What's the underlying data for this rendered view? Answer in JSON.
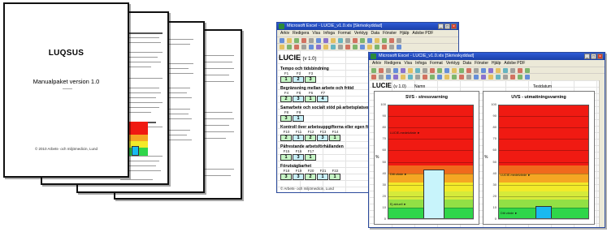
{
  "manual": {
    "title": "LUQSUS",
    "subtitle": "Manualpaket version 1.0",
    "copyright": "© 2010 Arbets- och miljömedicin, Lund"
  },
  "back_window": {
    "title_bar": "Microsoft Excel - LUCIE_v1.0.xls [Skrivskyddad]",
    "menu": [
      "Arkiv",
      "Redigera",
      "Visa",
      "Infoga",
      "Format",
      "Verktyg",
      "Data",
      "Fönster",
      "Hjälp",
      "Adobe PDF"
    ],
    "sheet_title": "LUCIE",
    "sheet_version": "(v 1.0)",
    "sections": [
      {
        "heading": "Tempo och tidsbindning",
        "labels": [
          "F1",
          "F2",
          "F3"
        ],
        "values": [
          "1",
          "2",
          "3"
        ]
      },
      {
        "heading": "Begränsning mellan arbete och fritid",
        "labels": [
          "F4",
          "F5",
          "F6",
          "F7"
        ],
        "values": [
          "2",
          "3",
          "1",
          "4"
        ]
      },
      {
        "heading": "Samarbete och socialt stöd på arbetsplatsen",
        "labels": [
          "F8",
          "F9"
        ],
        "values": [
          "3",
          "1"
        ]
      },
      {
        "heading": "Kontroll över arbetsuppgifterna eller egen förmåga",
        "labels": [
          "F10",
          "F11",
          "F12",
          "F13",
          "F14"
        ],
        "values": [
          "2",
          "1",
          "2",
          "3",
          "1"
        ]
      },
      {
        "heading": "Påfrestande arbetsförhållanden",
        "labels": [
          "F15",
          "F16",
          "F17"
        ],
        "values": [
          "1",
          "3",
          "1"
        ]
      },
      {
        "heading": "Förutsägbarhet",
        "labels": [
          "F18",
          "F19",
          "F20",
          "F21",
          "F22"
        ],
        "values": [
          "3",
          "3",
          "2",
          "1",
          "1"
        ]
      }
    ],
    "footer": "© Arbets- och miljömedicin, Lund"
  },
  "front_window": {
    "title_bar": "Microsoft Excel - LUCIE_v1.0.xls [Skrivskyddad]",
    "menu": [
      "Arkiv",
      "Redigera",
      "Visa",
      "Infoga",
      "Format",
      "Verktyg",
      "Data",
      "Fönster",
      "Hjälp",
      "Adobe PDF"
    ],
    "sheet_title": "LUCIE",
    "sheet_version": "(v 1.0)",
    "name_label": "Namn",
    "date_label": "Testdatum",
    "charts": [
      {
        "title": "SVS - stressvarning",
        "ylabel": "%"
      },
      {
        "title": "UVS - utmattningsvarning",
        "ylabel": "%"
      }
    ]
  },
  "chart_data": [
    {
      "type": "bar",
      "title": "SVS - stressvarning",
      "ylabel": "%",
      "ylim": [
        0,
        100
      ],
      "yticks": [
        "0",
        "10",
        "20",
        "30",
        "40",
        "50",
        "60",
        "70",
        "80",
        "90",
        "100"
      ],
      "values": [
        43
      ],
      "bands": [
        {
          "from": 0,
          "to": 10,
          "color": "#2fd64a"
        },
        {
          "from": 10,
          "to": 17,
          "color": "#92e045"
        },
        {
          "from": 17,
          "to": 24,
          "color": "#d6ea3a"
        },
        {
          "from": 24,
          "to": 32,
          "color": "#f2ea2a"
        },
        {
          "from": 32,
          "to": 40,
          "color": "#f5a623"
        },
        {
          "from": 40,
          "to": 47,
          "color": "#f06a1c"
        },
        {
          "from": 47,
          "to": 100,
          "color": "#f01a12"
        }
      ],
      "annotations": [
        "LUCIE-medelvärde",
        "Ditt värde",
        "Ej aktuell"
      ],
      "bar_color": "#c8f4fb"
    },
    {
      "type": "bar",
      "title": "UVS - utmattningsvarning",
      "ylabel": "%",
      "ylim": [
        0,
        100
      ],
      "yticks": [
        "0",
        "10",
        "20",
        "30",
        "40",
        "50",
        "60",
        "70",
        "80",
        "90",
        "100"
      ],
      "values": [
        11
      ],
      "bands": [
        {
          "from": 0,
          "to": 10,
          "color": "#2fd64a"
        },
        {
          "from": 10,
          "to": 17,
          "color": "#92e045"
        },
        {
          "from": 17,
          "to": 24,
          "color": "#d6ea3a"
        },
        {
          "from": 24,
          "to": 32,
          "color": "#f2ea2a"
        },
        {
          "from": 32,
          "to": 40,
          "color": "#f5a623"
        },
        {
          "from": 40,
          "to": 47,
          "color": "#f06a1c"
        },
        {
          "from": 47,
          "to": 100,
          "color": "#f01a12"
        }
      ],
      "annotations": [
        "LUCIE-medelvärde",
        "Ditt värde"
      ],
      "bar_color": "#19b9f0"
    }
  ]
}
